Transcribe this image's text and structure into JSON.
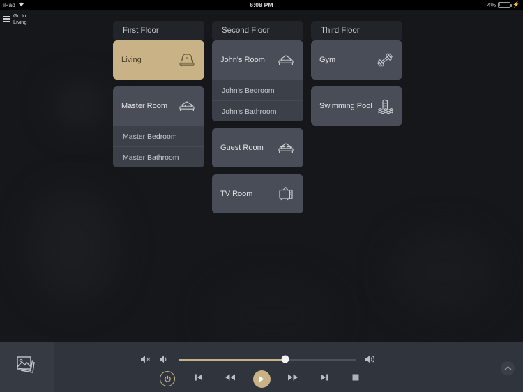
{
  "statusbar": {
    "device": "iPad",
    "wifi_icon": "wifi-icon",
    "time": "6:08 PM",
    "battery_percent": "4%",
    "battery_icon": "battery-charging-icon"
  },
  "topnav": {
    "menu_icon": "hamburger-menu-icon",
    "menu_label": "Go to\nLiving",
    "floor_tabs": [
      {
        "label": "First Floor",
        "name": "tab-first-floor"
      },
      {
        "label": "Second Floor",
        "name": "tab-second-floor"
      },
      {
        "label": "Third Floor",
        "name": "tab-third-floor"
      }
    ]
  },
  "columns": [
    {
      "name": "column-first-floor",
      "cards": [
        {
          "title": "Living",
          "icon": "sofa-icon",
          "active": true,
          "sub_items": []
        },
        {
          "title": "Master Room",
          "icon": "bed-icon",
          "active": false,
          "sub_items": [
            "Master Bedroom",
            "Master Bathroom"
          ]
        }
      ]
    },
    {
      "name": "column-second-floor",
      "cards": [
        {
          "title": "John's Room",
          "icon": "bed-icon",
          "active": false,
          "sub_items": [
            "John's Bedroom",
            "John's Bathroom"
          ]
        },
        {
          "title": "Guest Room",
          "icon": "bed-icon",
          "active": false,
          "sub_items": []
        },
        {
          "title": "TV Room",
          "icon": "tv-icon",
          "active": false,
          "sub_items": []
        }
      ]
    },
    {
      "name": "column-third-floor",
      "cards": [
        {
          "title": "Gym",
          "icon": "dumbbell-icon",
          "active": false,
          "sub_items": []
        },
        {
          "title": "Swimming Pool",
          "icon": "pool-ladder-icon",
          "active": false,
          "sub_items": []
        }
      ]
    }
  ],
  "bottombar": {
    "media_thumb_icon": "photos-stack-icon",
    "volume": {
      "mute_icon": "volume-mute-icon",
      "down_icon": "volume-down-icon",
      "up_icon": "volume-up-icon",
      "level_percent": 60
    },
    "transport": [
      {
        "name": "power-button",
        "icon": "power-icon",
        "highlighted": false
      },
      {
        "name": "previous-track-button",
        "icon": "previous-track-icon",
        "highlighted": false
      },
      {
        "name": "rewind-button",
        "icon": "rewind-icon",
        "highlighted": false
      },
      {
        "name": "play-button",
        "icon": "play-icon",
        "highlighted": true
      },
      {
        "name": "fast-forward-button",
        "icon": "fast-forward-icon",
        "highlighted": false
      },
      {
        "name": "next-track-button",
        "icon": "next-track-icon",
        "highlighted": false
      },
      {
        "name": "stop-button",
        "icon": "stop-icon",
        "highlighted": false
      }
    ],
    "expand_icon": "chevron-up-icon"
  },
  "colors": {
    "accent": "#c9b286",
    "card": "#484d57",
    "sub_item": "#3b4049",
    "bar": "#2f343d",
    "background": "#15171a",
    "tab": "#212429"
  }
}
